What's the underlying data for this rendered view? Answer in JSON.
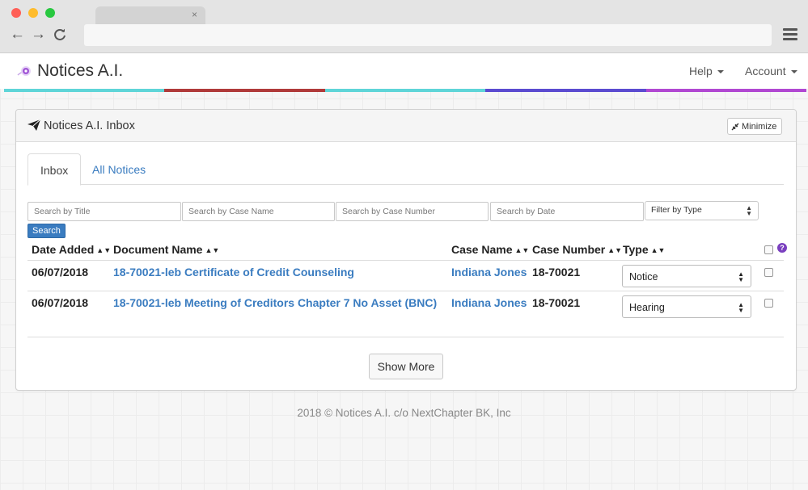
{
  "browser": {
    "tab_close": "×",
    "back_icon": "←",
    "forward_icon": "→",
    "reload_icon": "C"
  },
  "navbar": {
    "brand": "Notices A.I.",
    "help": "Help",
    "account": "Account",
    "stripe_colors": [
      "#5fd5d8",
      "#b03a3a",
      "#5fd5d8",
      "#5b4bd0",
      "#b148d2"
    ]
  },
  "panel": {
    "title": "Notices A.I. Inbox",
    "minimize_label": "Minimize",
    "tabs": [
      {
        "label": "Inbox",
        "active": true
      },
      {
        "label": "All Notices",
        "active": false
      }
    ]
  },
  "filters": {
    "title_placeholder": "Search by Title",
    "case_name_placeholder": "Search by Case Name",
    "case_number_placeholder": "Search by Case Number",
    "date_placeholder": "Search by Date",
    "type_selected": "Filter by Type",
    "search_label": "Search"
  },
  "table": {
    "columns": [
      "Date Added",
      "Document Name",
      "Case Name",
      "Case Number",
      "Type"
    ],
    "help_icon": "?",
    "rows": [
      {
        "date": "06/07/2018",
        "document": "18-70021-leb Certificate of Credit Counseling",
        "case_name": "Indiana Jones",
        "case_number": "18-70021",
        "type": "Notice",
        "checked": false
      },
      {
        "date": "06/07/2018",
        "document": "18-70021-leb Meeting of Creditors Chapter 7 No Asset (BNC)",
        "case_name": "Indiana Jones",
        "case_number": "18-70021",
        "type": "Hearing",
        "checked": false
      }
    ]
  },
  "show_more_label": "Show More",
  "footer": "2018 © Notices A.I. c/o NextChapter BK, Inc",
  "colors": {
    "link": "#3a7cc0",
    "primary_button": "#3a7cc0",
    "help_badge": "#7a3fbf"
  }
}
